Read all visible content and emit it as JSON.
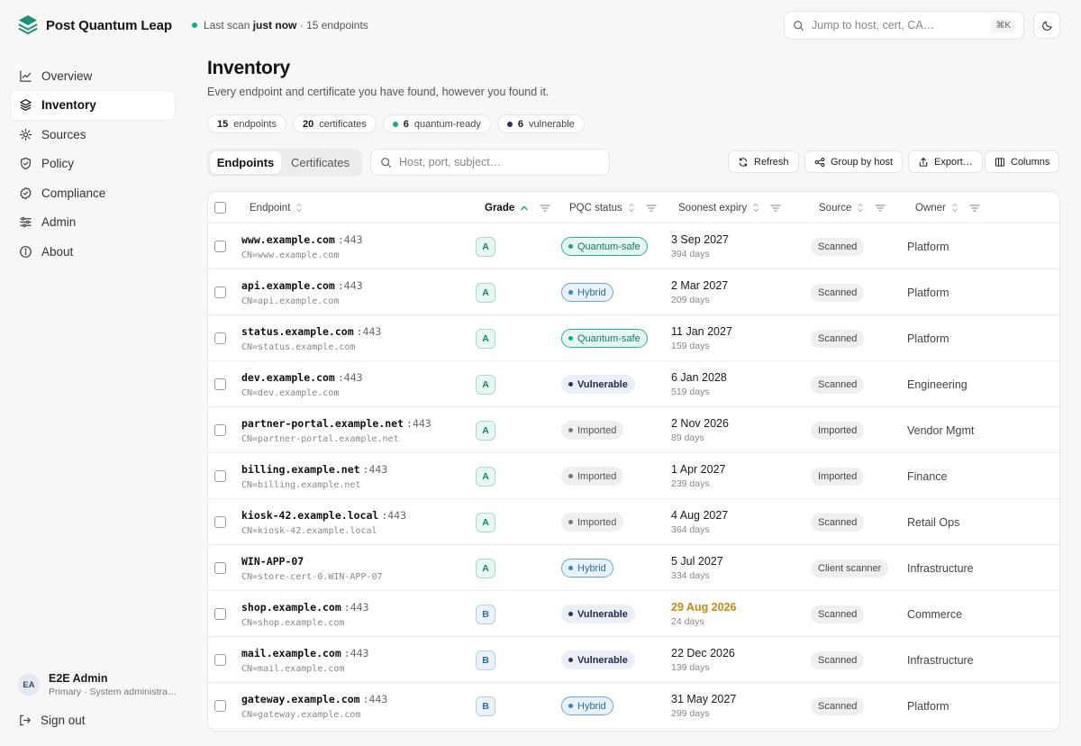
{
  "app": {
    "name": "Post Quantum Leap"
  },
  "status": {
    "prefix": "Last scan",
    "bold": "just now",
    "suffix": "· 15 endpoints"
  },
  "search": {
    "placeholder": "Jump to host, cert, CA…",
    "shortcut": "⌘K"
  },
  "nav": [
    {
      "label": "Overview",
      "icon": "chart-line-icon"
    },
    {
      "label": "Inventory",
      "icon": "layers-icon",
      "active": true
    },
    {
      "label": "Sources",
      "icon": "radar-icon"
    },
    {
      "label": "Policy",
      "icon": "shield-icon"
    },
    {
      "label": "Compliance",
      "icon": "badge-check-icon"
    },
    {
      "label": "Admin",
      "icon": "sliders-icon"
    },
    {
      "label": "About",
      "icon": "info-icon"
    }
  ],
  "user": {
    "initials": "EA",
    "name": "E2E Admin",
    "role": "Primary · System administra…"
  },
  "signout": "Sign out",
  "page": {
    "title": "Inventory",
    "subtitle": "Every endpoint and certificate you have found, however you found it."
  },
  "stats": [
    {
      "count": "15",
      "label": "endpoints"
    },
    {
      "count": "20",
      "label": "certificates"
    },
    {
      "count": "6",
      "label": "quantum-ready",
      "color": "#14a88a"
    },
    {
      "count": "6",
      "label": "vulnerable",
      "color": "#26336b"
    }
  ],
  "tabs": [
    "Endpoints",
    "Certificates"
  ],
  "filter": {
    "placeholder": "Host, port, subject…"
  },
  "toolbar": {
    "refresh": "Refresh",
    "group": "Group by host",
    "export": "Export…",
    "columns": "Columns"
  },
  "columns": {
    "endpoint": "Endpoint",
    "grade": "Grade",
    "pqc": "PQC status",
    "expiry": "Soonest expiry",
    "source": "Source",
    "owner": "Owner"
  },
  "rows": [
    {
      "host": "www.example.com",
      "port": ":443",
      "cn": "CN=www.example.com",
      "grade": "A",
      "pqc": "Quantum-safe",
      "pqc_kind": "qs",
      "expiry": "3 Sep 2027",
      "days": "394 days",
      "source": "Scanned",
      "owner": "Platform"
    },
    {
      "host": "api.example.com",
      "port": ":443",
      "cn": "CN=api.example.com",
      "grade": "A",
      "pqc": "Hybrid",
      "pqc_kind": "hy",
      "expiry": "2 Mar 2027",
      "days": "209 days",
      "source": "Scanned",
      "owner": "Platform"
    },
    {
      "host": "status.example.com",
      "port": ":443",
      "cn": "CN=status.example.com",
      "grade": "A",
      "pqc": "Quantum-safe",
      "pqc_kind": "qs",
      "expiry": "11 Jan 2027",
      "days": "159 days",
      "source": "Scanned",
      "owner": "Platform"
    },
    {
      "host": "dev.example.com",
      "port": ":443",
      "cn": "CN=dev.example.com",
      "grade": "A",
      "pqc": "Vulnerable",
      "pqc_kind": "vu",
      "expiry": "6 Jan 2028",
      "days": "519 days",
      "source": "Scanned",
      "owner": "Engineering"
    },
    {
      "host": "partner-portal.example.net",
      "port": ":443",
      "cn": "CN=partner-portal.example.net",
      "grade": "A",
      "pqc": "Imported",
      "pqc_kind": "im",
      "expiry": "2 Nov 2026",
      "days": "89 days",
      "source": "Imported",
      "owner": "Vendor Mgmt"
    },
    {
      "host": "billing.example.net",
      "port": ":443",
      "cn": "CN=billing.example.net",
      "grade": "A",
      "pqc": "Imported",
      "pqc_kind": "im",
      "expiry": "1 Apr 2027",
      "days": "239 days",
      "source": "Imported",
      "owner": "Finance"
    },
    {
      "host": "kiosk-42.example.local",
      "port": ":443",
      "cn": "CN=kiosk-42.example.local",
      "grade": "A",
      "pqc": "Imported",
      "pqc_kind": "im",
      "expiry": "4 Aug 2027",
      "days": "364 days",
      "source": "Scanned",
      "owner": "Retail Ops"
    },
    {
      "host": "WIN-APP-07",
      "port": "",
      "cn": "CN=store-cert-0.WIN-APP-07",
      "grade": "A",
      "pqc": "Hybrid",
      "pqc_kind": "hy",
      "expiry": "5 Jul 2027",
      "days": "334 days",
      "source": "Client scanner",
      "owner": "Infrastructure"
    },
    {
      "host": "shop.example.com",
      "port": ":443",
      "cn": "CN=shop.example.com",
      "grade": "B",
      "pqc": "Vulnerable",
      "pqc_kind": "vu",
      "expiry": "29 Aug 2026",
      "days": "24 days",
      "warn": true,
      "source": "Scanned",
      "owner": "Commerce"
    },
    {
      "host": "mail.example.com",
      "port": ":443",
      "cn": "CN=mail.example.com",
      "grade": "B",
      "pqc": "Vulnerable",
      "pqc_kind": "vu",
      "expiry": "22 Dec 2026",
      "days": "139 days",
      "source": "Scanned",
      "owner": "Infrastructure"
    },
    {
      "host": "gateway.example.com",
      "port": ":443",
      "cn": "CN=gateway.example.com",
      "grade": "B",
      "pqc": "Hybrid",
      "pqc_kind": "hy",
      "expiry": "31 May 2027",
      "days": "299 days",
      "source": "Scanned",
      "owner": "Platform"
    }
  ]
}
